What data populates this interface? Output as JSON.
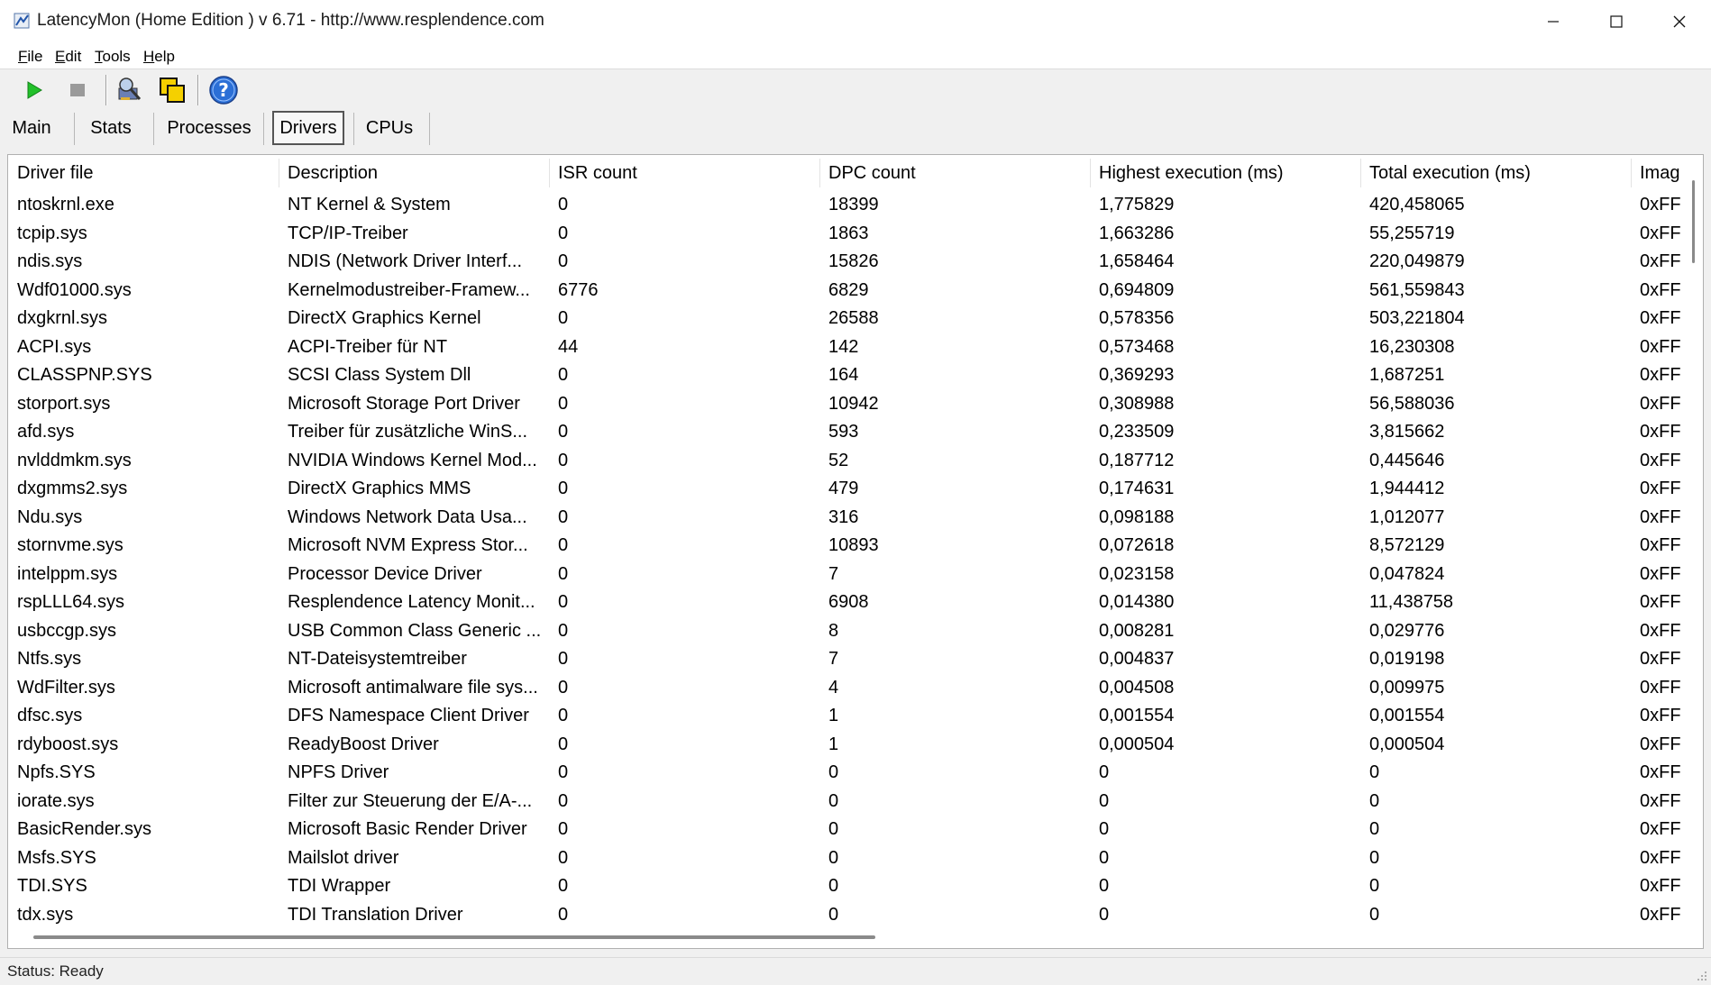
{
  "window": {
    "title": "LatencyMon  (Home Edition )  v 6.71 - http://www.resplendence.com"
  },
  "menu": [
    {
      "key": "F",
      "rest": "ile"
    },
    {
      "key": "E",
      "rest": "dit"
    },
    {
      "key": "T",
      "rest": "ools"
    },
    {
      "key": "H",
      "rest": "elp"
    }
  ],
  "toolbar": {
    "start_icon": "play-icon",
    "stop_icon": "stop-icon",
    "tool_icon": "analyze-icon",
    "copy_icon": "copy-windows-icon",
    "help_icon": "help-icon"
  },
  "tabs": [
    {
      "label": "Main"
    },
    {
      "label": "Stats"
    },
    {
      "label": "Processes"
    },
    {
      "label": "Drivers",
      "active": true
    },
    {
      "label": "CPUs"
    }
  ],
  "table": {
    "columns": [
      "Driver file",
      "Description",
      "ISR count",
      "DPC count",
      "Highest execution (ms)",
      "Total execution (ms)",
      "Imag"
    ],
    "rows": [
      [
        "ntoskrnl.exe",
        "NT Kernel & System",
        "0",
        "18399",
        "1,775829",
        "420,458065",
        "0xFF"
      ],
      [
        "tcpip.sys",
        "TCP/IP-Treiber",
        "0",
        "1863",
        "1,663286",
        "55,255719",
        "0xFF"
      ],
      [
        "ndis.sys",
        "NDIS (Network Driver Interf...",
        "0",
        "15826",
        "1,658464",
        "220,049879",
        "0xFF"
      ],
      [
        "Wdf01000.sys",
        "Kernelmodustreiber-Framew...",
        "6776",
        "6829",
        "0,694809",
        "561,559843",
        "0xFF"
      ],
      [
        "dxgkrnl.sys",
        "DirectX Graphics Kernel",
        "0",
        "26588",
        "0,578356",
        "503,221804",
        "0xFF"
      ],
      [
        "ACPI.sys",
        "ACPI-Treiber für NT",
        "44",
        "142",
        "0,573468",
        "16,230308",
        "0xFF"
      ],
      [
        "CLASSPNP.SYS",
        "SCSI Class System Dll",
        "0",
        "164",
        "0,369293",
        "1,687251",
        "0xFF"
      ],
      [
        "storport.sys",
        "Microsoft Storage Port Driver",
        "0",
        "10942",
        "0,308988",
        "56,588036",
        "0xFF"
      ],
      [
        "afd.sys",
        "Treiber für zusätzliche WinS...",
        "0",
        "593",
        "0,233509",
        "3,815662",
        "0xFF"
      ],
      [
        "nvlddmkm.sys",
        "NVIDIA Windows Kernel Mod...",
        "0",
        "52",
        "0,187712",
        "0,445646",
        "0xFF"
      ],
      [
        "dxgmms2.sys",
        "DirectX Graphics MMS",
        "0",
        "479",
        "0,174631",
        "1,944412",
        "0xFF"
      ],
      [
        "Ndu.sys",
        "Windows Network Data Usa...",
        "0",
        "316",
        "0,098188",
        "1,012077",
        "0xFF"
      ],
      [
        "stornvme.sys",
        "Microsoft NVM Express Stor...",
        "0",
        "10893",
        "0,072618",
        "8,572129",
        "0xFF"
      ],
      [
        "intelppm.sys",
        "Processor Device Driver",
        "0",
        "7",
        "0,023158",
        "0,047824",
        "0xFF"
      ],
      [
        "rspLLL64.sys",
        "Resplendence Latency Monit...",
        "0",
        "6908",
        "0,014380",
        "11,438758",
        "0xFF"
      ],
      [
        "usbccgp.sys",
        "USB Common Class Generic ...",
        "0",
        "8",
        "0,008281",
        "0,029776",
        "0xFF"
      ],
      [
        "Ntfs.sys",
        "NT-Dateisystemtreiber",
        "0",
        "7",
        "0,004837",
        "0,019198",
        "0xFF"
      ],
      [
        "WdFilter.sys",
        "Microsoft antimalware file sys...",
        "0",
        "4",
        "0,004508",
        "0,009975",
        "0xFF"
      ],
      [
        "dfsc.sys",
        "DFS Namespace Client Driver",
        "0",
        "1",
        "0,001554",
        "0,001554",
        "0xFF"
      ],
      [
        "rdyboost.sys",
        "ReadyBoost Driver",
        "0",
        "1",
        "0,000504",
        "0,000504",
        "0xFF"
      ],
      [
        "Npfs.SYS",
        "NPFS Driver",
        "0",
        "0",
        "0",
        "0",
        "0xFF"
      ],
      [
        "iorate.sys",
        "Filter zur Steuerung der E/A-...",
        "0",
        "0",
        "0",
        "0",
        "0xFF"
      ],
      [
        "BasicRender.sys",
        "Microsoft Basic Render Driver",
        "0",
        "0",
        "0",
        "0",
        "0xFF"
      ],
      [
        "Msfs.SYS",
        "Mailslot driver",
        "0",
        "0",
        "0",
        "0",
        "0xFF"
      ],
      [
        "TDI.SYS",
        "TDI Wrapper",
        "0",
        "0",
        "0",
        "0",
        "0xFF"
      ],
      [
        "tdx.sys",
        "TDI Translation Driver",
        "0",
        "0",
        "0",
        "0",
        "0xFF"
      ]
    ]
  },
  "status": {
    "text": "Status: Ready"
  }
}
